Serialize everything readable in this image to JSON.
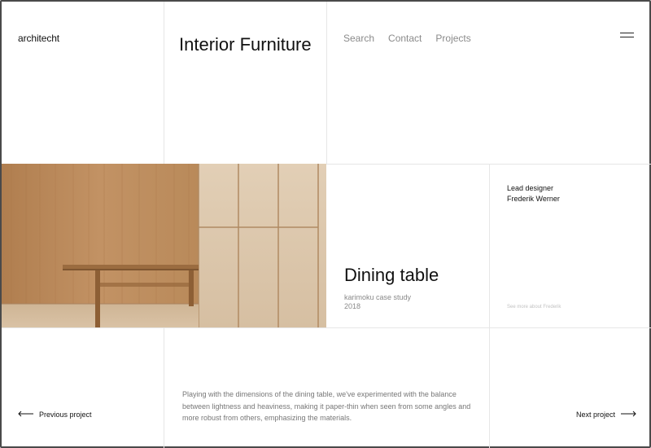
{
  "header": {
    "logo": "architecht",
    "title": "Interior Furniture",
    "nav": [
      "Search",
      "Contact",
      "Projects"
    ],
    "menu_icon": "hamburger-icon"
  },
  "project": {
    "image": "dining-table-photo",
    "title": "Dining table",
    "case_study": "karimoku case study",
    "year": "2018"
  },
  "designer": {
    "role": "Lead designer",
    "name": "Frederik Werner",
    "link": "See more about Frederik"
  },
  "description": "Playing with the dimensions of the dining table, we've experimented with the balance between lightness and heaviness, making it paper-thin when seen from some angles and more robust from others, emphasizing the materials.",
  "pagination": {
    "previous": "Previous project",
    "next": "Next project",
    "previous_icon": "arrow-left-icon",
    "next_icon": "arrow-right-icon"
  },
  "colors": {
    "text": "#111111",
    "muted": "#8a8a8a",
    "grid_line": "#e6e6e6",
    "wood": "#b98a5a",
    "panel": "#dcc6aa"
  }
}
